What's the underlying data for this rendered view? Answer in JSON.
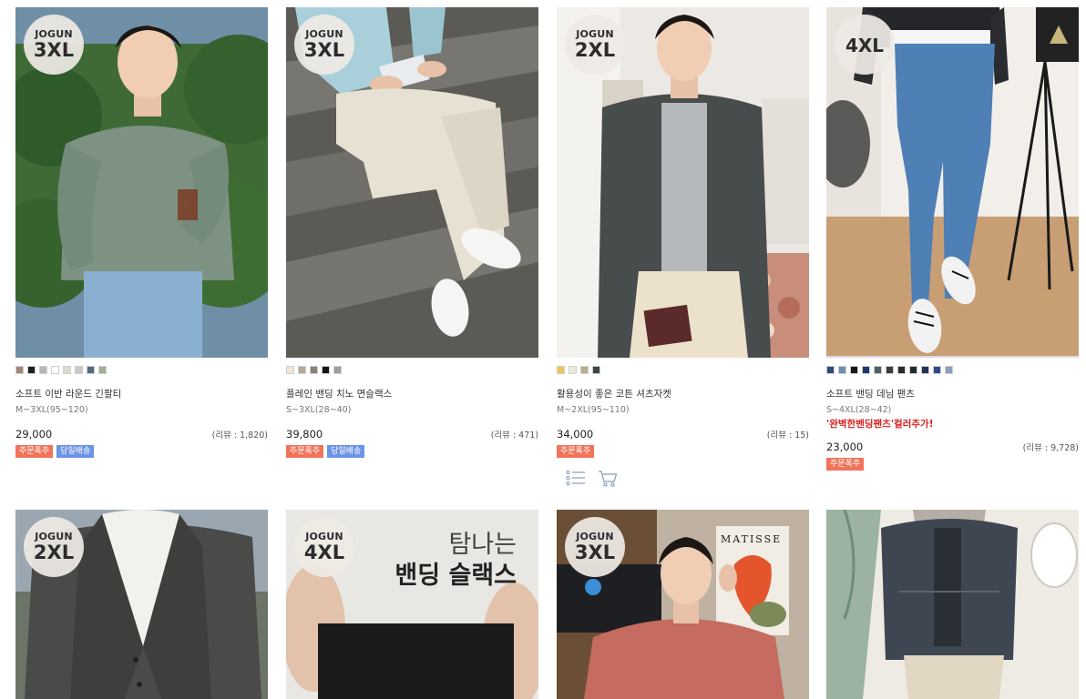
{
  "products": [
    {
      "badge_top": "JOGUN",
      "badge_size": "3XL",
      "colors": [
        "#a08879",
        "#1f1f1f",
        "#b6b6b6",
        "#ffffff",
        "#dcd8cc",
        "#c9c9c9",
        "#4f6b7e",
        "#a4b096"
      ],
      "name": "소프트 이반 라운드 긴팔티",
      "size": "M~3XL(95~120)",
      "price": "29,000",
      "review": "(리뷰 : 1,820)",
      "tags": [
        {
          "label": "주문폭주",
          "color": "orange"
        },
        {
          "label": "당일배송",
          "color": "blue"
        }
      ]
    },
    {
      "badge_top": "JOGUN",
      "badge_size": "3XL",
      "colors": [
        "#ede5d5",
        "#b6a796",
        "#8a8173",
        "#151515",
        "#9f9f9f"
      ],
      "name": "플레인 밴딩 치노 면슬랙스",
      "size": "S~3XL(28~40)",
      "price": "39,800",
      "review": "(리뷰 : 471)",
      "tags": [
        {
          "label": "주문폭주",
          "color": "orange"
        },
        {
          "label": "당일배송",
          "color": "blue"
        }
      ]
    },
    {
      "badge_top": "JOGUN",
      "badge_size": "2XL",
      "colors": [
        "#f2c45f",
        "#efe9dc",
        "#b9ad8c",
        "#3c4542"
      ],
      "name": "활용성이 좋은 코튼 셔츠자켓",
      "size": "M~2XL(95~110)",
      "price": "34,000",
      "review": "(리뷰 : 15)",
      "tags": [
        {
          "label": "주문폭주",
          "color": "orange"
        }
      ],
      "actions": [
        {
          "icon": "list-icon"
        },
        {
          "icon": "cart-icon"
        }
      ]
    },
    {
      "badge_top": "",
      "badge_size": "4XL",
      "colors": [
        "#2f4b7a",
        "#6f8eb4",
        "#15151a",
        "#1b3a73",
        "#4a5f6a",
        "#3b3b3b",
        "#2b2b2b",
        "#1f2833",
        "#22324f",
        "#2f4a8a",
        "#8aa1bd"
      ],
      "name": "소프트 밴딩 데님 팬츠",
      "size": "S~4XL(28~42)",
      "promo": "'완벽한밴딩팬츠'컬러추가!",
      "price": "23,000",
      "review": "(리뷰 : 9,728)",
      "tags": [
        {
          "label": "주문폭주",
          "color": "orange"
        }
      ]
    },
    {
      "badge_top": "JOGUN",
      "badge_size": "2XL"
    },
    {
      "badge_top": "JOGUN",
      "badge_size": "4XL",
      "image_text_1": "탐나는",
      "image_text_2": "밴딩 슬랙스"
    },
    {
      "badge_top": "JOGUN",
      "badge_size": "3XL",
      "image_text_1": "MATISSE"
    },
    {
      "badge_top": "",
      "badge_size": ""
    }
  ]
}
